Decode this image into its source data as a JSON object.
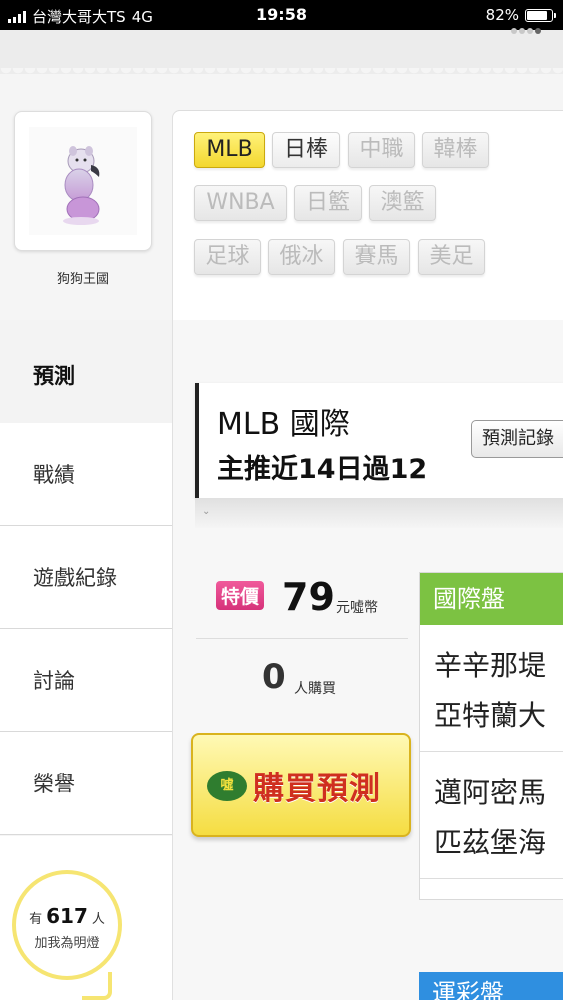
{
  "status_bar": {
    "carrier": "台灣大哥大TS",
    "network": "4G",
    "time": "19:58",
    "battery": "82%",
    "battery_level": 0.82
  },
  "profile": {
    "name": "狗狗王國"
  },
  "nav": {
    "items": [
      {
        "label": "預測",
        "active": true
      },
      {
        "label": "戰績"
      },
      {
        "label": "遊戲紀錄"
      },
      {
        "label": "討論"
      },
      {
        "label": "榮譽"
      }
    ]
  },
  "light": {
    "prefix": "有",
    "count": "617",
    "suffix": "人",
    "subtitle": "加我為明燈"
  },
  "tabs": [
    {
      "label": "MLB",
      "state": "active"
    },
    {
      "label": "日棒",
      "state": "normal"
    },
    {
      "label": "中職",
      "state": "disabled"
    },
    {
      "label": "韓棒",
      "state": "disabled"
    },
    {
      "label": "WNBA",
      "state": "disabled"
    },
    {
      "label": "日籃",
      "state": "disabled"
    },
    {
      "label": "澳籃",
      "state": "disabled"
    },
    {
      "label": "足球",
      "state": "disabled"
    },
    {
      "label": "俄冰",
      "state": "disabled"
    },
    {
      "label": "賽馬",
      "state": "disabled"
    },
    {
      "label": "美足",
      "state": "disabled"
    }
  ],
  "league": {
    "title": "MLB 國際",
    "subtitle": "主推近14日過12",
    "record_button": "預測記錄"
  },
  "price": {
    "badge": "特價",
    "amount": "79",
    "unit": "元噓幣"
  },
  "buyers": {
    "count": "0",
    "unit": "人購買"
  },
  "buy_button": {
    "icon_text": "噓",
    "label": "購買預測"
  },
  "international": {
    "header": "國際盤",
    "matches": [
      {
        "team1": "辛辛那堤",
        "team2": "亞特蘭大"
      },
      {
        "team1": "邁阿密馬",
        "team2": "匹茲堡海"
      }
    ]
  },
  "lottery": {
    "header": "運彩盤"
  }
}
